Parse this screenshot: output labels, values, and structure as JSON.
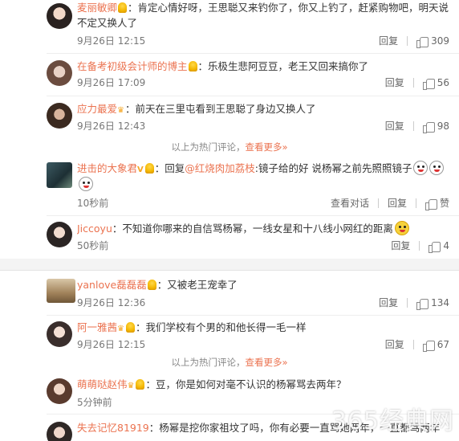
{
  "hot_notice": {
    "text": "以上为热门评论，",
    "more": "查看更多»"
  },
  "actions": {
    "reply": "回复",
    "view_conversation": "查看对话",
    "like_label": "赞"
  },
  "comments_top": [
    {
      "name": "麦丽敏卿",
      "text": "：肯定心情好呀，王思聪又来钓你了，你又上钓了，赶紧购物吧，明天说不定又换人了",
      "time": "9月26日 12:15",
      "likes": "309"
    },
    {
      "name": "在备考初级会计师的博主",
      "text": "：乐极生悲阿豆豆，老王又回来搞你了",
      "time": "9月26日 17:09",
      "likes": "56"
    },
    {
      "name": "应力最爱",
      "text": "：前天在三里屯看到王思聪了身边又换人了",
      "time": "9月26日 12:43",
      "likes": "98"
    }
  ],
  "comment_reply": {
    "name": "进击的大象君",
    "prefix": "：回复",
    "mention": "@红烧肉加荔枝",
    "text": ":镜子给的好 说杨幂之前先照照镜子",
    "time": "10秒前"
  },
  "comment_jiccoyu": {
    "name": "Jiccoyu",
    "text": "：不知道你哪来的自信骂杨幂，一线女星和十八线小网红的距离",
    "time": "50秒前",
    "likes": "4"
  },
  "comments_bottom": [
    {
      "name": "yanlove磊磊磊",
      "text": "：又被老王宠幸了",
      "time": "9月26日 12:36",
      "likes": "134"
    },
    {
      "name": "阿一雅茜",
      "text": "：我们学校有个男的和他长得一毛一样",
      "time": "9月26日 12:15",
      "likes": "67"
    }
  ],
  "comment_mengmeng": {
    "name": "萌萌哒赵伟",
    "text": "：豆，你是如何对毫不认识的杨幂骂去两年？",
    "time": "5分钟前"
  },
  "comment_last": {
    "name": "失去记忆81919",
    "text": "：杨幂是挖你家祖坟了吗，你有必要一直骂她两年，一直都骂两年"
  },
  "watermark": "365经典网"
}
